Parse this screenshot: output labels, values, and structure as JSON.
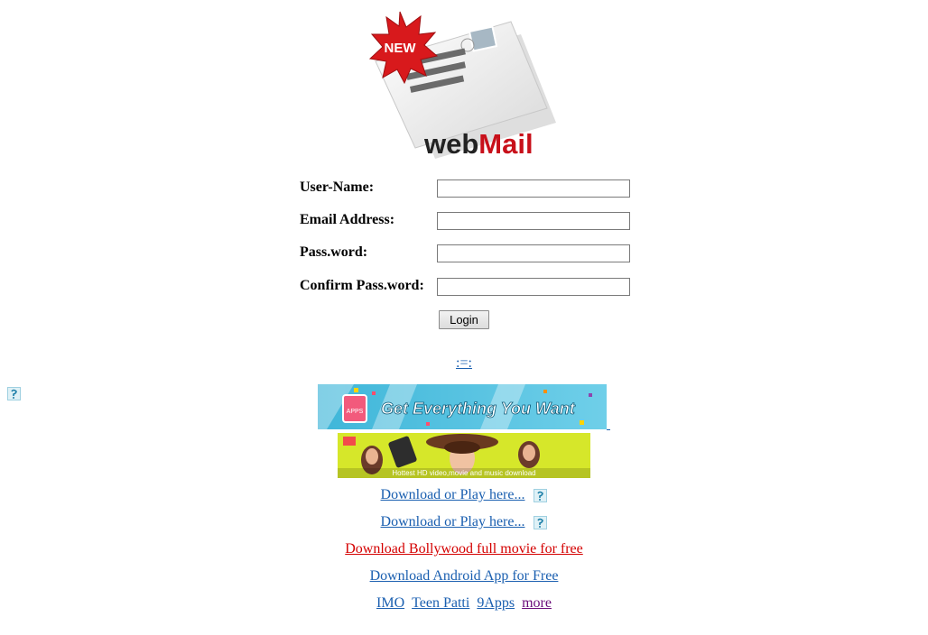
{
  "logo": {
    "badge": "NEW",
    "brand_prefix": "web",
    "brand_suffix": "Mail"
  },
  "form": {
    "username_label": "User-Name:",
    "email_label": "Email Address:",
    "password_label": "Pass.word:",
    "confirm_label": "Confirm Pass.word:",
    "username_value": "",
    "email_value": "",
    "password_value": "",
    "confirm_value": "",
    "login_label": "Login"
  },
  "menu_link": ":=:",
  "banner1": {
    "text": "Get Everything You Want",
    "badge": "APPS"
  },
  "banner2": {
    "caption": "Hottest HD video,movie and music download"
  },
  "links": {
    "download1": "Download or Play here...",
    "download2": "Download or Play here...",
    "bollywood": "Download Bollywood full movie for free",
    "android": "Download Android App for Free",
    "imo": "IMO",
    "teen_patti": "Teen Patti",
    "nine_apps": "9Apps",
    "more": "more"
  },
  "colors": {
    "link": "#1a5fb0",
    "link_red": "#d40000",
    "link_visited": "#6b0b7a",
    "badge_red": "#d8191c"
  },
  "icons": [
    "broken-image-icon",
    "envelope-icon",
    "new-starburst-icon"
  ]
}
